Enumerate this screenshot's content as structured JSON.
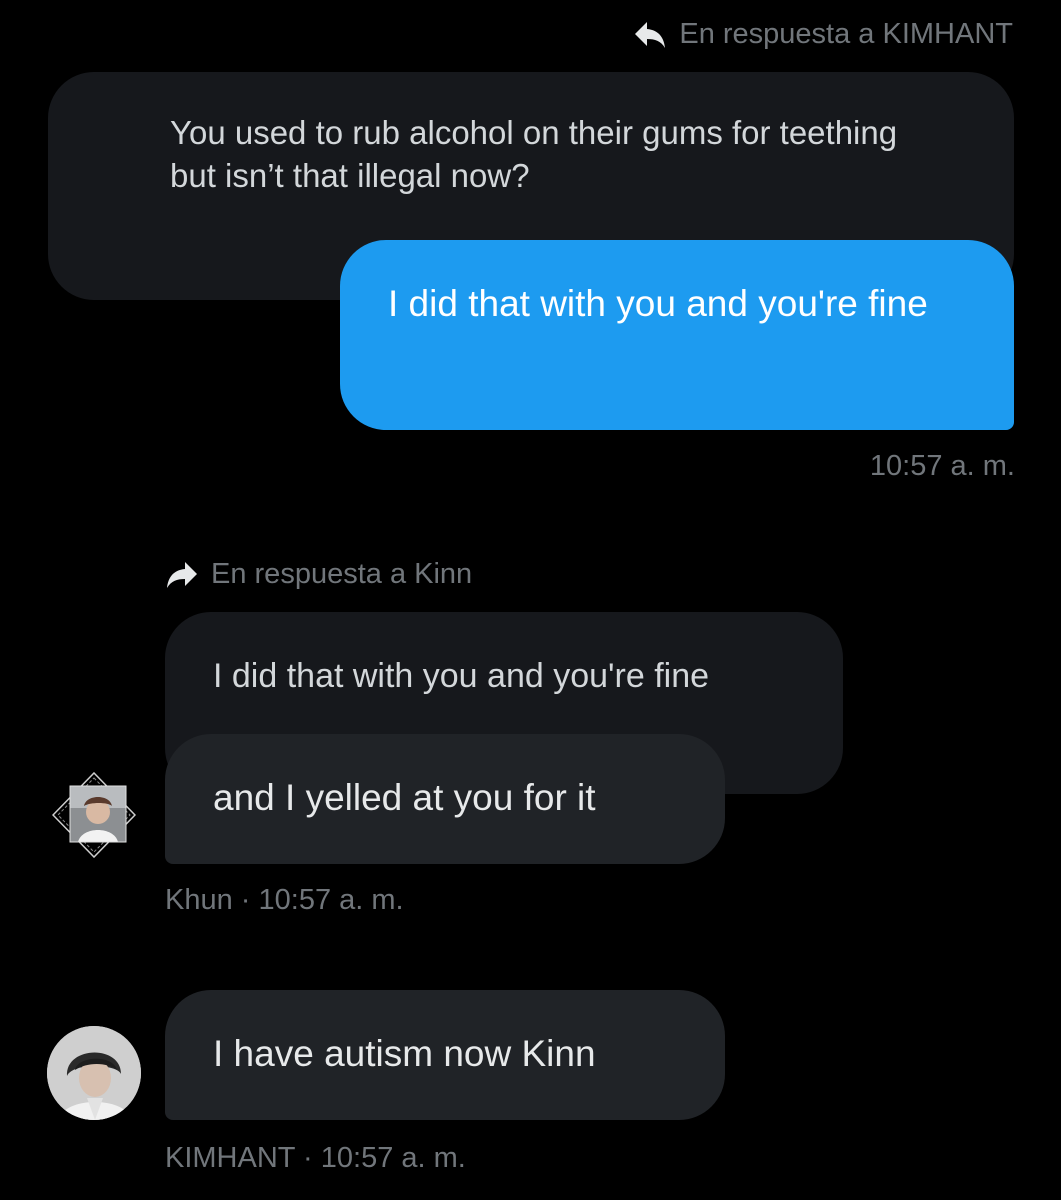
{
  "theme": {
    "background": "#000000",
    "sent_bubble": "#1d9bf0",
    "received_bubble": "#202327",
    "quoted_bubble": "#16181c",
    "meta_text": "#71767b",
    "text": "#e7e9ea"
  },
  "messages": [
    {
      "reply_label": "En respuesta a KIMHANT",
      "reply_icon": "reply-arrow-icon",
      "quoted_text": "You used to rub alcohol on their gums for teething but isn’t that illegal now?",
      "text": "I did that with you and you're fine",
      "timestamp": "10:57 a. m."
    },
    {
      "reply_label": "En respuesta a Kinn",
      "reply_icon": "forward-arrow-icon",
      "quoted_text": "I did that with you and you're fine",
      "text": "and I yelled at you for it",
      "sender": "Khun",
      "separator": "·",
      "timestamp": "10:57 a. m."
    },
    {
      "text": "I have autism now Kinn",
      "sender": "KIMHANT",
      "separator": "·",
      "timestamp": "10:57 a. m."
    }
  ]
}
